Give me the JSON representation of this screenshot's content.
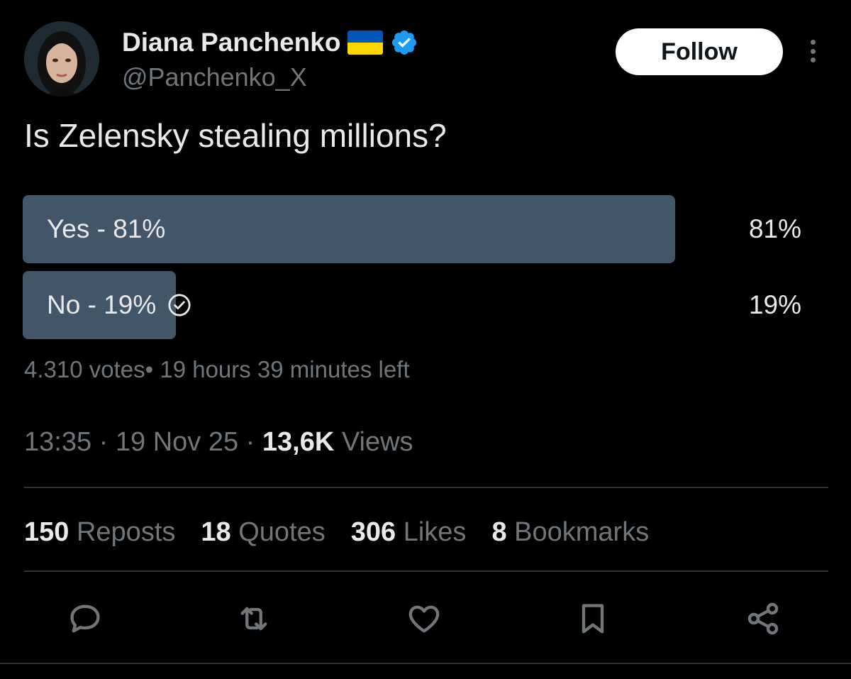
{
  "author": {
    "display_name": "Diana Panchenko",
    "handle": "@Panchenko_X",
    "flag_icon": "ukraine-flag-icon",
    "verified_icon": "verified-badge-icon",
    "verified_color": "#1d9bf0"
  },
  "follow_button": {
    "label": "Follow"
  },
  "tweet": {
    "text": "Is Zelensky stealing millions?"
  },
  "poll": {
    "options": [
      {
        "label": "Yes - 81%",
        "percent_text": "81%",
        "value": 81,
        "selected": false
      },
      {
        "label": "No - 19%",
        "percent_text": "19%",
        "value": 19,
        "selected": true
      }
    ],
    "bar_color": "#435667",
    "meta": "4.310 votes• 19 hours 39 minutes left"
  },
  "timestamp": {
    "time": "13:35",
    "separator": " · ",
    "date": "19 Nov 25",
    "views_count": "13,6K",
    "views_label": "Views"
  },
  "stats": [
    {
      "count": "150",
      "label": "Reposts"
    },
    {
      "count": "18",
      "label": "Quotes"
    },
    {
      "count": "306",
      "label": "Likes"
    },
    {
      "count": "8",
      "label": "Bookmarks"
    }
  ],
  "actions": [
    {
      "icon": "reply-icon"
    },
    {
      "icon": "repost-icon"
    },
    {
      "icon": "like-icon"
    },
    {
      "icon": "bookmark-icon"
    },
    {
      "icon": "share-icon"
    }
  ],
  "colors": {
    "background": "#000000",
    "primary_text": "#e7e9ea",
    "secondary_text": "#71767b",
    "divider": "#2f3336"
  }
}
